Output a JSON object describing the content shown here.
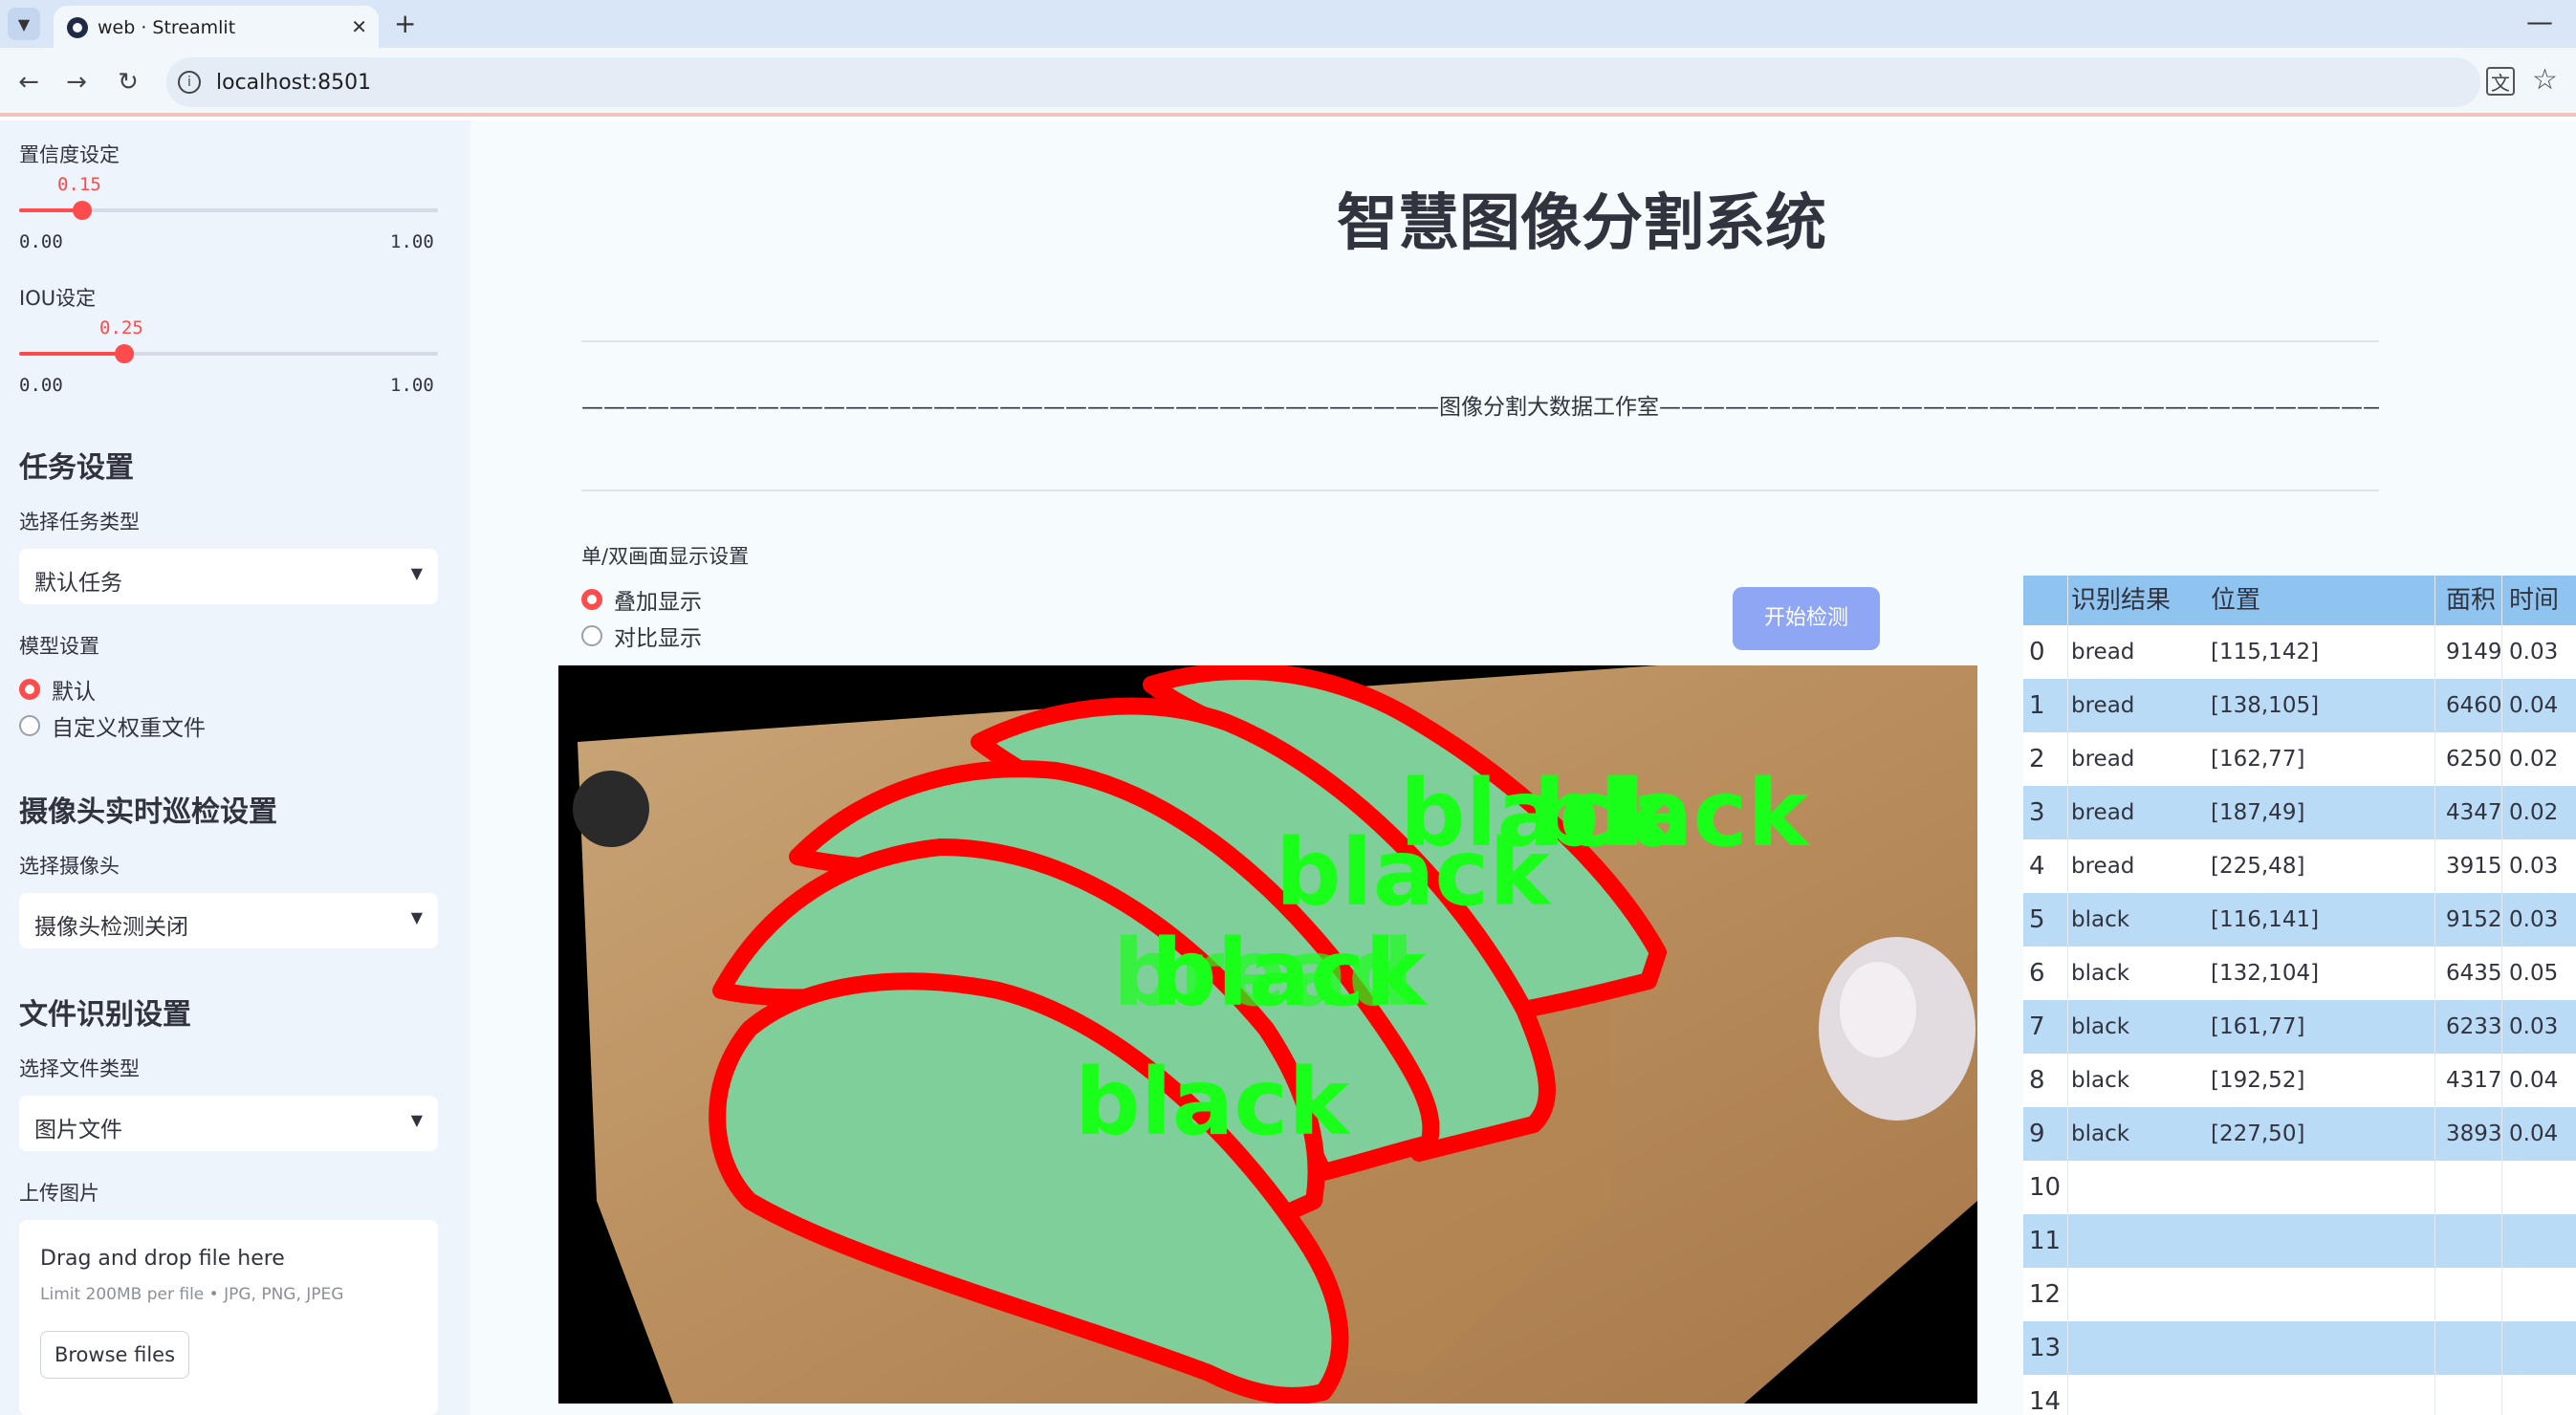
{
  "browser": {
    "tab_title": "web · Streamlit",
    "url": "localhost:8501"
  },
  "sidebar": {
    "confidence": {
      "label": "置信度设定",
      "value": "0.15",
      "fraction": 0.15,
      "min": "0.00",
      "max": "1.00"
    },
    "iou": {
      "label": "IOU设定",
      "value": "0.25",
      "fraction": 0.25,
      "min": "0.00",
      "max": "1.00"
    },
    "task_header": "任务设置",
    "task_type_label": "选择任务类型",
    "task_type_value": "默认任务",
    "model_label": "模型设置",
    "model_options": [
      "默认",
      "自定义权重文件"
    ],
    "camera_header": "摄像头实时巡检设置",
    "camera_label": "选择摄像头",
    "camera_value": "摄像头检测关闭",
    "file_header": "文件识别设置",
    "file_type_label": "选择文件类型",
    "file_type_value": "图片文件",
    "upload_label": "上传图片",
    "upload_title": "Drag and drop file here",
    "upload_limit": "Limit 200MB per file • JPG, PNG, JPEG",
    "browse_label": "Browse files"
  },
  "main": {
    "title": "智慧图像分割系统",
    "studio_line": "———————————————————————————————————————图像分割大数据工作室———————————————————————————————————————",
    "display_label": "单/双画面显示设置",
    "display_options": [
      "叠加显示",
      "对比显示"
    ],
    "start_button": "开始检测",
    "overlay_words": [
      "black",
      "black",
      "black",
      "black",
      "bread",
      "black"
    ]
  },
  "table": {
    "headers": [
      "",
      "识别结果",
      "位置",
      "面积",
      "时间"
    ],
    "rows": [
      [
        "0",
        "bread",
        "[115,142]",
        "9149",
        "0.03"
      ],
      [
        "1",
        "bread",
        "[138,105]",
        "6460",
        "0.04"
      ],
      [
        "2",
        "bread",
        "[162,77]",
        "6250",
        "0.02"
      ],
      [
        "3",
        "bread",
        "[187,49]",
        "4347",
        "0.02"
      ],
      [
        "4",
        "bread",
        "[225,48]",
        "3915",
        "0.03"
      ],
      [
        "5",
        "black",
        "[116,141]",
        "9152",
        "0.03"
      ],
      [
        "6",
        "black",
        "[132,104]",
        "6435",
        "0.05"
      ],
      [
        "7",
        "black",
        "[161,77]",
        "6233",
        "0.03"
      ],
      [
        "8",
        "black",
        "[192,52]",
        "4317",
        "0.04"
      ],
      [
        "9",
        "black",
        "[227,50]",
        "3893",
        "0.04"
      ],
      [
        "10",
        "",
        "",
        "",
        ""
      ],
      [
        "11",
        "",
        "",
        "",
        ""
      ],
      [
        "12",
        "",
        "",
        "",
        ""
      ],
      [
        "13",
        "",
        "",
        "",
        ""
      ],
      [
        "14",
        "",
        "",
        "",
        ""
      ]
    ]
  },
  "colors": {
    "accent": "#ff4b4b",
    "button": "#8fa6f5",
    "table_header": "#8fc3f0",
    "table_alt": "#b9dbf6",
    "mask": "#7fcf9a",
    "outline": "#ff0000",
    "label_text": "#1aff1a"
  }
}
